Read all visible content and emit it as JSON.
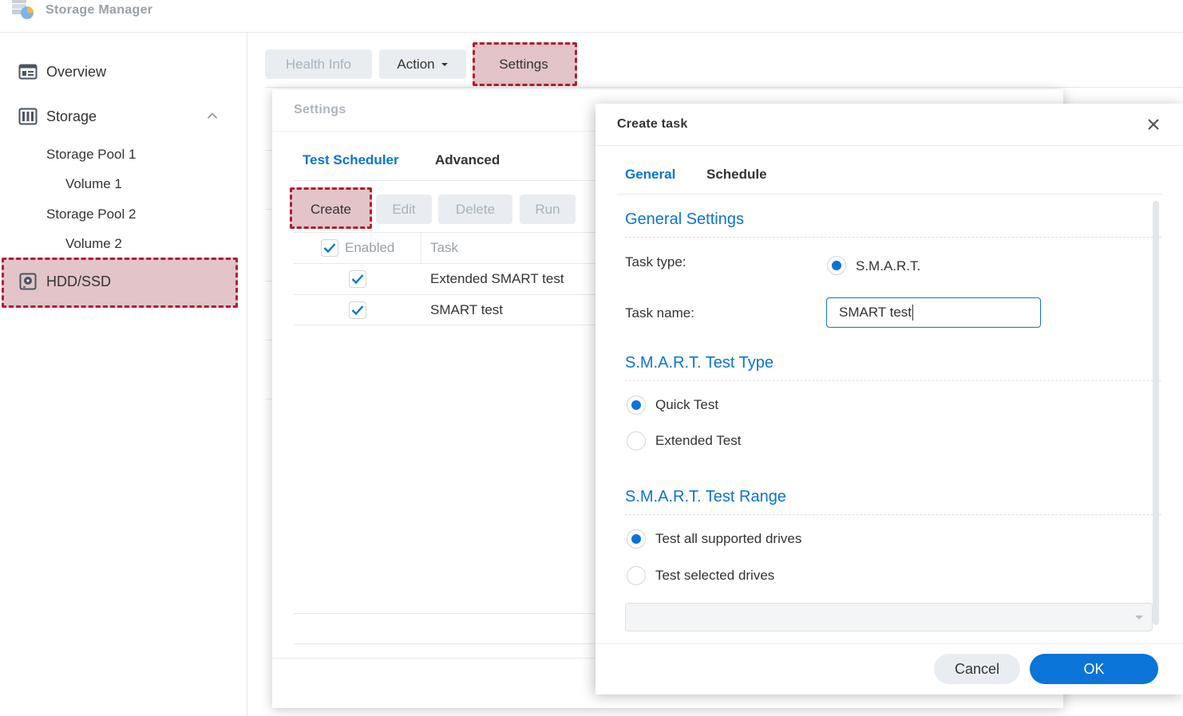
{
  "app": {
    "title": "Storage Manager",
    "icon": "storage-manager-app-icon"
  },
  "sidebar": {
    "items": [
      {
        "label": "Overview",
        "icon": "overview-icon"
      },
      {
        "label": "Storage",
        "icon": "storage-icon",
        "expanded": true
      },
      {
        "label": "Storage Pool 1"
      },
      {
        "label": "Volume 1"
      },
      {
        "label": "Storage Pool 2"
      },
      {
        "label": "Volume 2"
      },
      {
        "label": "HDD/SSD",
        "icon": "hdd-icon",
        "selected": true
      }
    ]
  },
  "toolbar": {
    "health_info": "Health Info",
    "action": "Action",
    "settings": "Settings"
  },
  "settings_dialog": {
    "title": "Settings",
    "tabs": [
      "Test Scheduler",
      "Advanced"
    ],
    "active_tab": "Test Scheduler",
    "buttons": {
      "create": "Create",
      "edit": "Edit",
      "delete": "Delete",
      "run": "Run"
    },
    "columns": {
      "enabled": "Enabled",
      "task": "Task"
    },
    "rows": [
      {
        "enabled": true,
        "task": "Extended SMART test"
      },
      {
        "enabled": true,
        "task": "SMART test"
      }
    ]
  },
  "create_task": {
    "title": "Create task",
    "tabs": [
      "General",
      "Schedule"
    ],
    "active_tab": "General",
    "general_settings": {
      "heading": "General Settings",
      "task_type_label": "Task type:",
      "task_type_value": "S.M.A.R.T.",
      "task_name_label": "Task name:",
      "task_name_value": "SMART test"
    },
    "test_type": {
      "heading": "S.M.A.R.T. Test Type",
      "options": [
        "Quick Test",
        "Extended Test"
      ],
      "selected": "Quick Test"
    },
    "test_range": {
      "heading": "S.M.A.R.T. Test Range",
      "options": [
        "Test all supported drives",
        "Test selected drives"
      ],
      "selected": "Test all supported drives"
    },
    "buttons": {
      "cancel": "Cancel",
      "ok": "OK"
    }
  },
  "colors": {
    "accent": "#0a74d8",
    "highlight_border": "#b0202e",
    "highlight_fill": "#e2c4c9"
  }
}
